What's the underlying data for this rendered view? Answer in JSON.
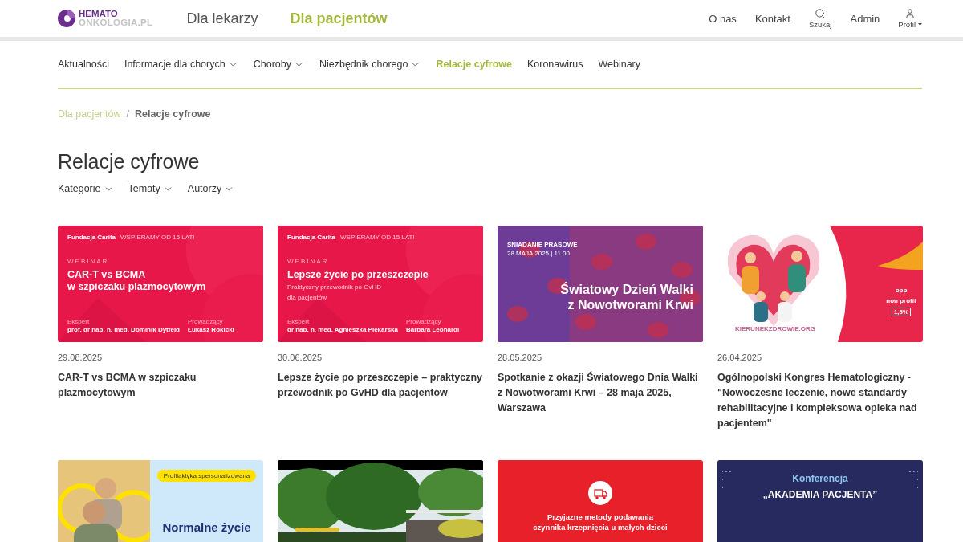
{
  "header": {
    "logo": {
      "line_1": "HEMATO",
      "line_2": "ONKOLOGIA.PL"
    },
    "sections": [
      {
        "label": "Dla lekarzy",
        "selected": false
      },
      {
        "label": "Dla pacjentów",
        "selected": true
      }
    ],
    "links": [
      {
        "label": "O nas",
        "kind": "text"
      },
      {
        "label": "Kontakt",
        "kind": "text"
      },
      {
        "label": "Szukaj",
        "kind": "search"
      },
      {
        "label": "Admin",
        "kind": "text"
      },
      {
        "label": "Profil",
        "kind": "profile"
      }
    ]
  },
  "menu": [
    {
      "label": "Aktualności",
      "dropdown": false,
      "selected": false
    },
    {
      "label": "Informacje dla chorych",
      "dropdown": true,
      "selected": false
    },
    {
      "label": "Choroby",
      "dropdown": true,
      "selected": false
    },
    {
      "label": "Niezbędnik chorego",
      "dropdown": true,
      "selected": false
    },
    {
      "label": "Relacje cyfrowe",
      "dropdown": false,
      "selected": true
    },
    {
      "label": "Koronawirus",
      "dropdown": false,
      "selected": false
    },
    {
      "label": "Webinary",
      "dropdown": false,
      "selected": false
    }
  ],
  "breadcrumb": [
    {
      "label": "Dla pacjentów",
      "current": false
    },
    {
      "separator": "/",
      "label": "Relacje cyfrowe",
      "current": true
    }
  ],
  "title": "Relacje cyfrowe",
  "filters": [
    "Kategorie",
    "Tematy",
    "Autorzy"
  ],
  "cards": [
    {
      "date": "29.08.2025",
      "title": "CAR-T vs BCMA w szpiczaku plazmocytowym",
      "thumbnail": {
        "kind": "webinar",
        "brand": "Fundacja Carita",
        "tagline": "WSPIERAMY OD 15 LAT!",
        "tag": "WEBINAR",
        "headline": [
          "CAR-T vs BCMA",
          "w szpiczaku plazmocytowym"
        ],
        "expert_label": "Ekspert",
        "expert": "prof. dr hab. n. med. Dominik Dytfeld",
        "host_label": "Prowadzący",
        "host": "Łukasz Rokicki"
      }
    },
    {
      "date": "30.06.2025",
      "title": "Lepsze życie po przeszczepie – praktyczny przewodnik po GvHD dla pacjentów",
      "thumbnail": {
        "kind": "webinar",
        "brand": "Fundacja Carita",
        "tagline": "WSPIERAMY OD 15 LAT!",
        "tag": "WEBINAR",
        "headline": [
          "Lepsze życie po przeszczepie"
        ],
        "subtitle": [
          "Praktyczny przewodnik po GvHD",
          "dla pacjentów"
        ],
        "expert_label": "Ekspert",
        "expert": "dr hab. n. med. Agnieszka Piekarska",
        "host_label": "Prowadzący",
        "host": "Barbara Leonardi"
      }
    },
    {
      "date": "28.05.2025",
      "title": "Spotkanie z okazji Światowego Dnia Walki z Nowotworami Krwi – 28 maja 2025, Warszawa",
      "thumbnail": {
        "kind": "event",
        "label": "ŚNIADANIE PRASOWE",
        "when": "28 MAJA 2025 | 11.00",
        "headline": [
          "Światowy Dzień Walki",
          "z Nowotworami Krwi"
        ]
      }
    },
    {
      "date": "26.04.2025",
      "title": "Ogólnopolski Kongres Hematologiczny - \"Nowoczesne leczenie, nowe standardy rehabilitacyjne i kompleksowa opieka nad pacjentem\"",
      "thumbnail": {
        "kind": "campaign",
        "site": "KIERUNEKZDROWIE.ORG",
        "badges": [
          "opp",
          "non profit",
          "1,5%"
        ]
      }
    },
    {
      "thumbnail": {
        "kind": "promo",
        "pill": "Profilaktyka spersonalizowana",
        "headline": "Normalne życie"
      }
    },
    {
      "thumbnail": {
        "kind": "video"
      }
    },
    {
      "thumbnail": {
        "kind": "emblem",
        "headline": [
          "Przyjazne metody podawania",
          "czynnika krzepnięcia u małych dzieci"
        ]
      }
    },
    {
      "thumbnail": {
        "kind": "conference",
        "label": "Konferencja",
        "name": "„AKADEMIA PACJENTA”"
      }
    }
  ]
}
